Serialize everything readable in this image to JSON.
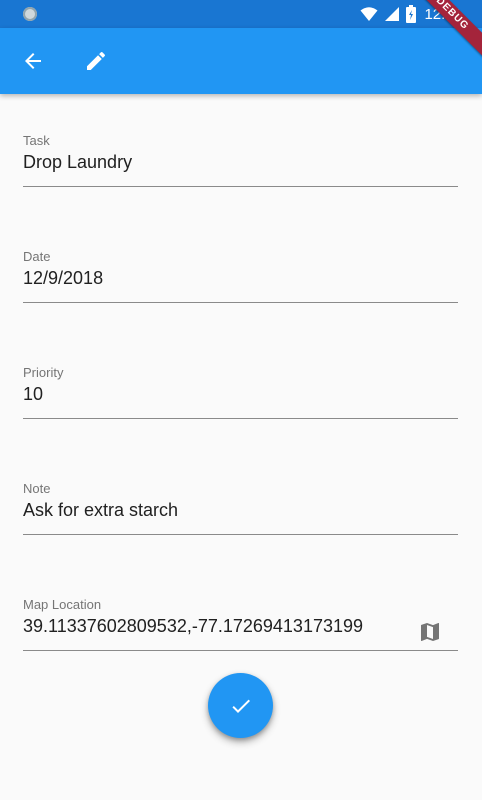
{
  "status_bar": {
    "time": "12:41"
  },
  "debug_banner": "DEBUG",
  "app_bar": {
    "back_icon": "arrow-back-icon",
    "edit_icon": "pencil-icon"
  },
  "form": {
    "task": {
      "label": "Task",
      "value": "Drop Laundry"
    },
    "date": {
      "label": "Date",
      "value": "12/9/2018"
    },
    "priority": {
      "label": "Priority",
      "value": "10"
    },
    "note": {
      "label": "Note",
      "value": "Ask for extra starch"
    },
    "map_location": {
      "label": "Map Location",
      "value": "39.11337602809532,-77.17269413173199",
      "icon": "map-icon"
    }
  },
  "fab": {
    "icon": "check-icon"
  },
  "colors": {
    "primary": "#2196f3",
    "primary_dark": "#1976d2",
    "debug": "#a4243b"
  }
}
